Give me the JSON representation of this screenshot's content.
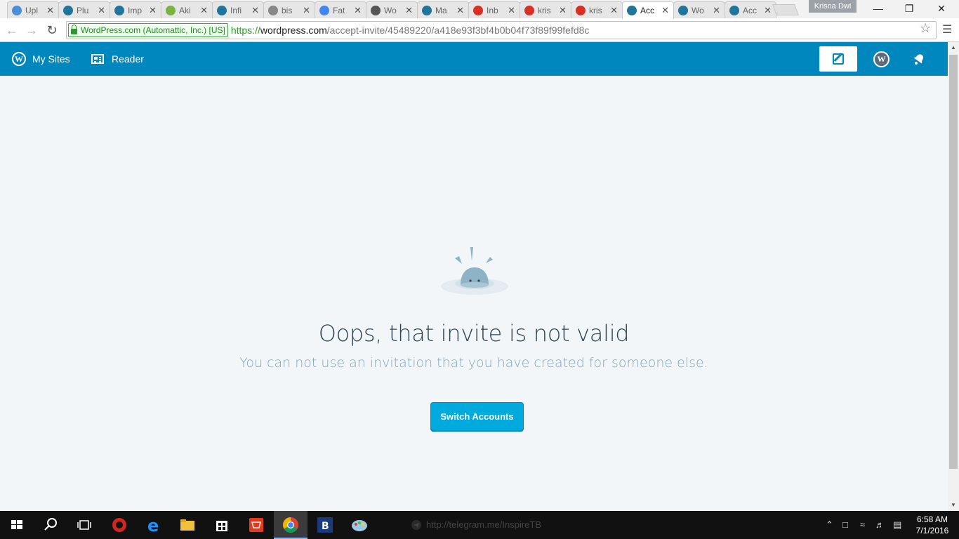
{
  "browser": {
    "tabs": [
      {
        "title": "Upl",
        "icon": "page-icon",
        "color": "#4a90d9"
      },
      {
        "title": "Plu",
        "icon": "wordpress-icon",
        "color": "#21759b"
      },
      {
        "title": "Imp",
        "icon": "wordpress-icon",
        "color": "#21759b"
      },
      {
        "title": "Aki",
        "icon": "akismet-icon",
        "color": "#7bb342"
      },
      {
        "title": "Infi",
        "icon": "wordpress-icon",
        "color": "#21759b"
      },
      {
        "title": "bis",
        "icon": "document-icon",
        "color": "#888888"
      },
      {
        "title": "Fat",
        "icon": "google-icon",
        "color": "#4285f4"
      },
      {
        "title": "Wo",
        "icon": "chat-icon",
        "color": "#555555"
      },
      {
        "title": "Ma",
        "icon": "wordpress-icon",
        "color": "#21759b"
      },
      {
        "title": "Inb",
        "icon": "gmail-icon",
        "color": "#d93025"
      },
      {
        "title": "kris",
        "icon": "gmail-icon",
        "color": "#d93025"
      },
      {
        "title": "kris",
        "icon": "gmail-icon",
        "color": "#d93025"
      },
      {
        "title": "Acc",
        "icon": "wordpress-icon",
        "color": "#21759b",
        "active": true
      },
      {
        "title": "Wo",
        "icon": "wordpress-icon",
        "color": "#21759b"
      },
      {
        "title": "Acc",
        "icon": "wordpress-icon",
        "color": "#21759b"
      }
    ],
    "profile_name": "Krisna Dwi",
    "ev_label": "WordPress.com (Automattic, Inc.) [US]",
    "url_scheme": "https://",
    "url_host": "wordpress.com",
    "url_path": "/accept-invite/45489220/a418e93f3bf4b0b04f73f89f99fefd8c"
  },
  "masterbar": {
    "my_sites": "My Sites",
    "reader": "Reader",
    "me_avatar": "W"
  },
  "main": {
    "title": "Oops, that invite is not valid",
    "subtitle": "You can not use an invitation that you have created for someone else.",
    "button": "Switch Accounts"
  },
  "taskbar": {
    "telegram_text": "http://telegram.me/InspireTB",
    "time": "6:58 AM",
    "date": "7/1/2016"
  },
  "colors": {
    "masterbar": "#0087be",
    "button": "#00aadc",
    "title": "#2e4453",
    "subtitle": "#87a6bc",
    "background": "#f3f6f8"
  }
}
